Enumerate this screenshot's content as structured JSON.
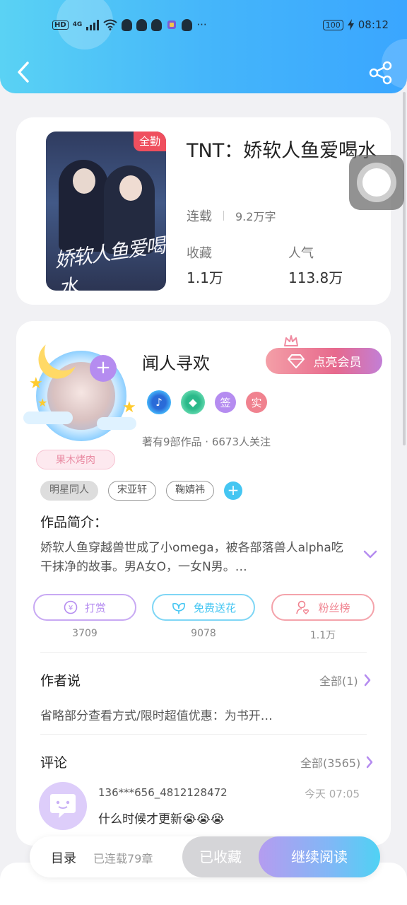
{
  "status_bar": {
    "network": "4G",
    "hd": "HD",
    "more": "···",
    "battery": "100",
    "time": "08:12"
  },
  "book": {
    "cover_badge": "全勤",
    "cover_script": "娇软人鱼爱喝水",
    "title": "TNT：娇软人鱼爱喝水",
    "status": "连载",
    "word_count": "9.2万字",
    "favorites_label": "收藏",
    "favorites_value": "1.1万",
    "popularity_label": "人气",
    "popularity_value": "113.8万"
  },
  "author": {
    "name": "闻人寻欢",
    "vip_button": "点亮会员",
    "badge_sign": "签",
    "badge_real": "实",
    "stats": "著有9部作品 · 6673人关注",
    "name_plate": "果木烤肉"
  },
  "tags": [
    "明星同人",
    "宋亚轩",
    "鞠婧祎"
  ],
  "summary": {
    "heading": "作品简介：",
    "text": "娇软人鱼穿越兽世成了小omega，被各部落兽人alpha吃干抹净的故事。男A女O，一女N男。…"
  },
  "actions": [
    {
      "label": "打赏",
      "count": "3709",
      "color": "#b58cf0"
    },
    {
      "label": "免费送花",
      "count": "9078",
      "color": "#45c6f2"
    },
    {
      "label": "粉丝榜",
      "count": "1.1万",
      "color": "#f0828f"
    }
  ],
  "author_says": {
    "heading": "作者说",
    "more": "全部(1)",
    "text": "省略部分查看方式/限时超值优惠：为书开…"
  },
  "comments": {
    "heading": "评论",
    "more": "全部(3565)",
    "items": [
      {
        "user": "136***656_4812128472",
        "time": "今天 07:05",
        "text": "什么时候才更新😭😭😭"
      }
    ]
  },
  "bottom_bar": {
    "toc": "目录",
    "chapters": "已连载79章",
    "collected": "已收藏",
    "continue": "继续阅读"
  },
  "colors": {
    "header_start": "#5ad2f4",
    "header_end": "#3aa6ff",
    "accent_purple": "#b58cf0",
    "accent_blue": "#45c6f2",
    "accent_red": "#f0828f"
  }
}
